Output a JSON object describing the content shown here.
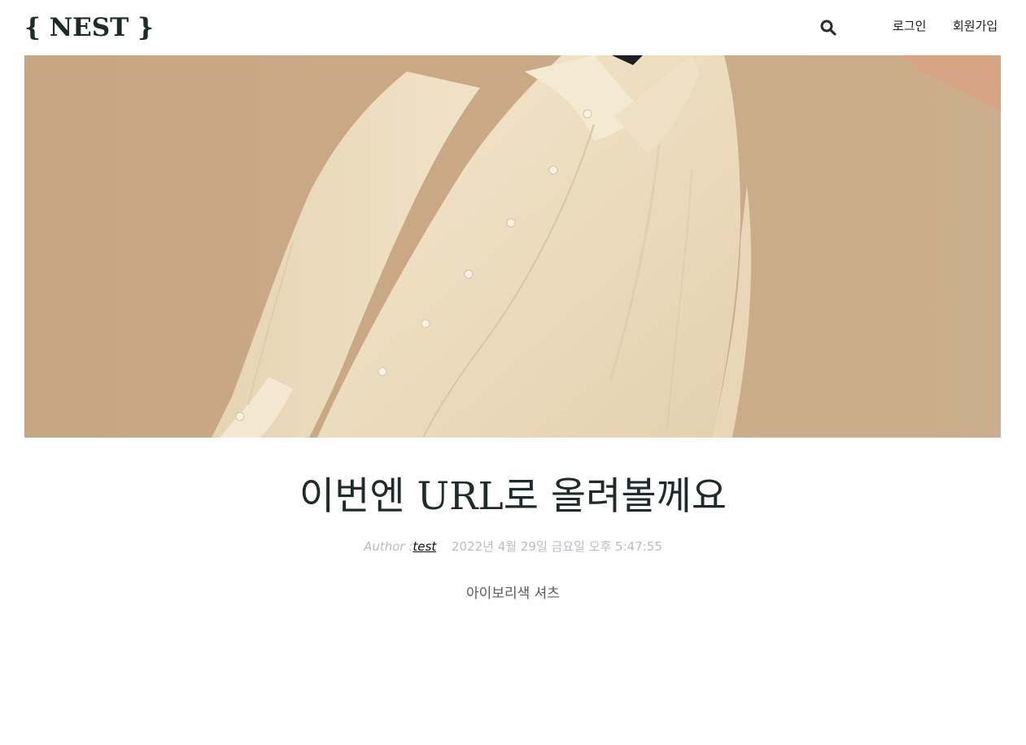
{
  "header": {
    "logo": "{ NEST }",
    "search_icon": "search-icon",
    "nav": {
      "login": "로그인",
      "signup": "회원가입"
    }
  },
  "hero": {
    "image": "ivory-shirt-photo"
  },
  "post": {
    "title": "이번엔 URL로 올려볼께요",
    "author_label": "Author :",
    "author_name": "test",
    "date": "2022년 4월 29일 금요일 오후 5:47:55",
    "body": "아이보리색 셔츠"
  },
  "colors": {
    "background": "#ffffff",
    "logo": "#1d2b2a",
    "title": "#1d2b2a",
    "meta": "#b8bcc4",
    "hero_backdrop": "#c9a987",
    "shirt": "#eedfc4"
  }
}
